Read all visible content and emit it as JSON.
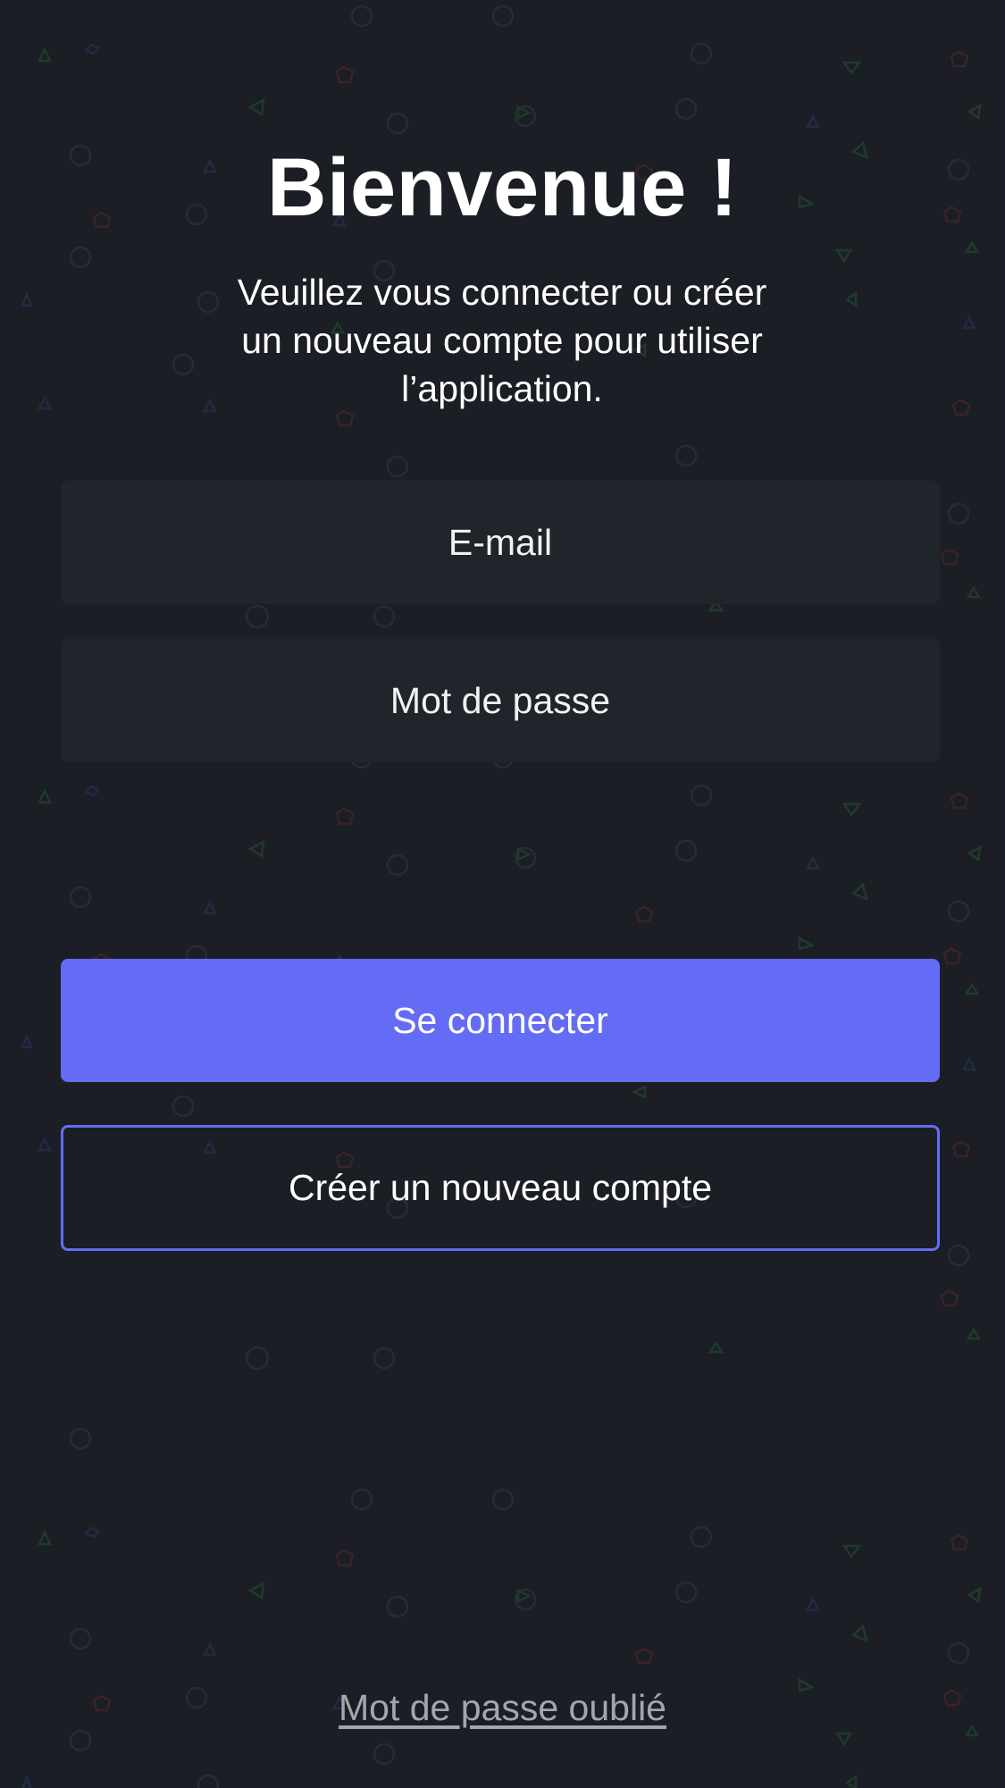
{
  "header": {
    "title": "Bienvenue !",
    "subtitle": "Veuillez vous connecter ou créer un nouveau compte pour utiliser l’application."
  },
  "form": {
    "email_placeholder": "E-mail",
    "email_value": "",
    "password_placeholder": "Mot de passe",
    "password_value": ""
  },
  "actions": {
    "login_label": "Se connecter",
    "create_account_label": "Créer un nouveau compte",
    "forgot_password_label": "Mot de passe oublié"
  },
  "theme": {
    "background": "#1b1e24",
    "field_background": "#20252b",
    "accent": "#646cf5",
    "pattern_icons": [
      "circle-icon",
      "star-icon",
      "triangle-icon",
      "pentagon-icon"
    ]
  }
}
